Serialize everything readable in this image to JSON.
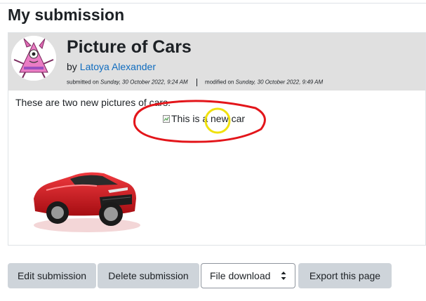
{
  "page": {
    "heading": "My submission"
  },
  "submission": {
    "title": "Picture of Cars",
    "by_word": "by",
    "author": "Latoya Alexander",
    "submitted_label": "submitted on",
    "submitted_date": "Sunday, 30 October 2022, 9:24 AM",
    "modified_label": "modified on",
    "modified_date": "Sunday, 30 October 2022, 9:49 AM",
    "body_text": "These are two new pictures of cars.",
    "broken_image_alt": "This is a new car"
  },
  "actions": {
    "edit_label": "Edit submission",
    "delete_label": "Delete submission",
    "download_select_value": "File download",
    "export_label": "Export this page"
  },
  "colors": {
    "link": "#0f6cbf",
    "header_band": "#e0e0e0",
    "button_bg": "#ced4da",
    "annotation_red": "#e3151a",
    "annotation_yellow": "#f0e10e",
    "car_red": "#d4141b"
  }
}
